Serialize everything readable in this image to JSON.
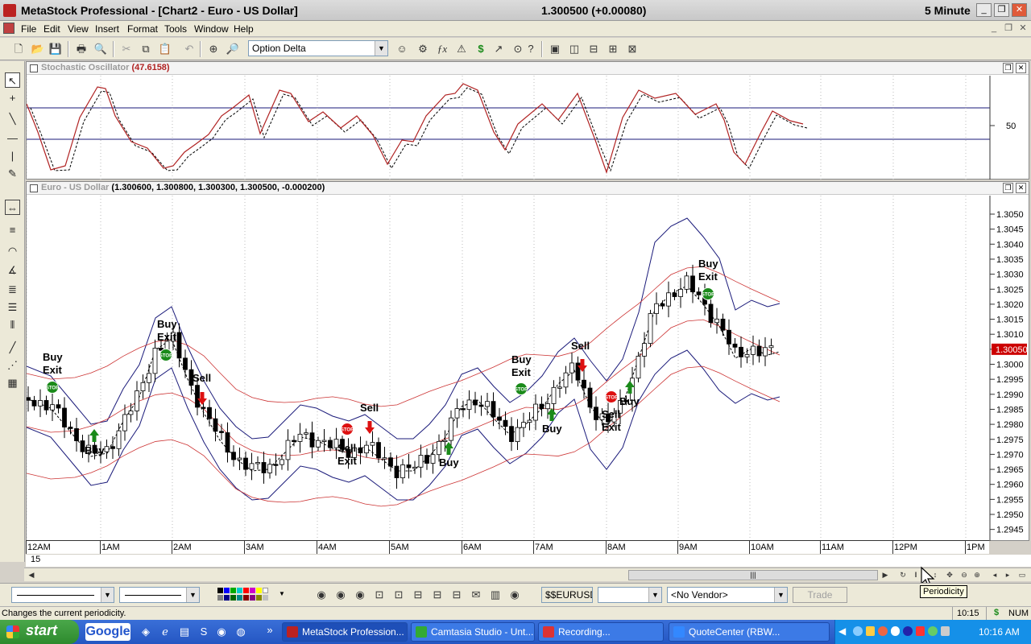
{
  "window": {
    "app_name": "MetaStock Professional",
    "doc": "[Chart2 - Euro - US Dollar]",
    "quote": "1.300500 (+0.00080)",
    "periodicity": "5 Minute"
  },
  "menu": [
    "File",
    "Edit",
    "View",
    "Insert",
    "Format",
    "Tools",
    "Window",
    "Help"
  ],
  "toolbar": {
    "expert_combo": "Option Delta",
    "dollar_label": "$"
  },
  "stoch_pane": {
    "title": "Stochastic Oscillator",
    "value": "(47.6158)",
    "y_label": "50"
  },
  "price_pane": {
    "title": "Euro - US Dollar",
    "ohlc": "(1.300600, 1.300800, 1.300300, 1.300500, -0.000200)",
    "y_ticks": [
      "1.3050",
      "1.3045",
      "1.3040",
      "1.3035",
      "1.3030",
      "1.3025",
      "1.3020",
      "1.3015",
      "1.3010",
      "1.3005",
      "1.3000",
      "1.2995",
      "1.2990",
      "1.2985",
      "1.2980",
      "1.2975",
      "1.2970",
      "1.2965",
      "1.2960",
      "1.2955",
      "1.2950",
      "1.2945"
    ],
    "last_price": "1.30050",
    "signals": {
      "buy": "Buy",
      "sell": "Sell",
      "exit": "Exit",
      "stop": "STOP"
    }
  },
  "x_axis": {
    "ticks": [
      "12AM",
      "1AM",
      "2AM",
      "3AM",
      "4AM",
      "5AM",
      "6AM",
      "7AM",
      "8AM",
      "9AM",
      "10AM",
      "11AM",
      "12PM",
      "1PM"
    ],
    "day_label": "15"
  },
  "bottom_toolbar": {
    "symbol": "$$EURUSD",
    "vendor": "<No Vendor>",
    "trade": "Trade"
  },
  "tooltip": "Periodicity",
  "status": {
    "message": "Changes the current periodicity.",
    "time": "10:15",
    "currency": "$",
    "num": "NUM"
  },
  "taskbar": {
    "start": "start",
    "google": "Google",
    "tasks": [
      "MetaStock Profession...",
      "Camtasia Studio - Unt...",
      "Recording...",
      "QuoteCenter    (RBW..."
    ],
    "clock": "10:16 AM"
  },
  "colors": {
    "kline": "#b02222",
    "dline": "#000000",
    "bb_outer": "#1a1a7a",
    "bb_inner": "#cc3333",
    "buy_arrow": "#1a8a1a",
    "sell_arrow": "#dd1111",
    "last_price_bg": "#cc0000"
  },
  "icons": [
    "start-windows-icon",
    "stop-sign-icon",
    "arrow-up-icon",
    "arrow-down-icon",
    "cursor-icon"
  ]
}
